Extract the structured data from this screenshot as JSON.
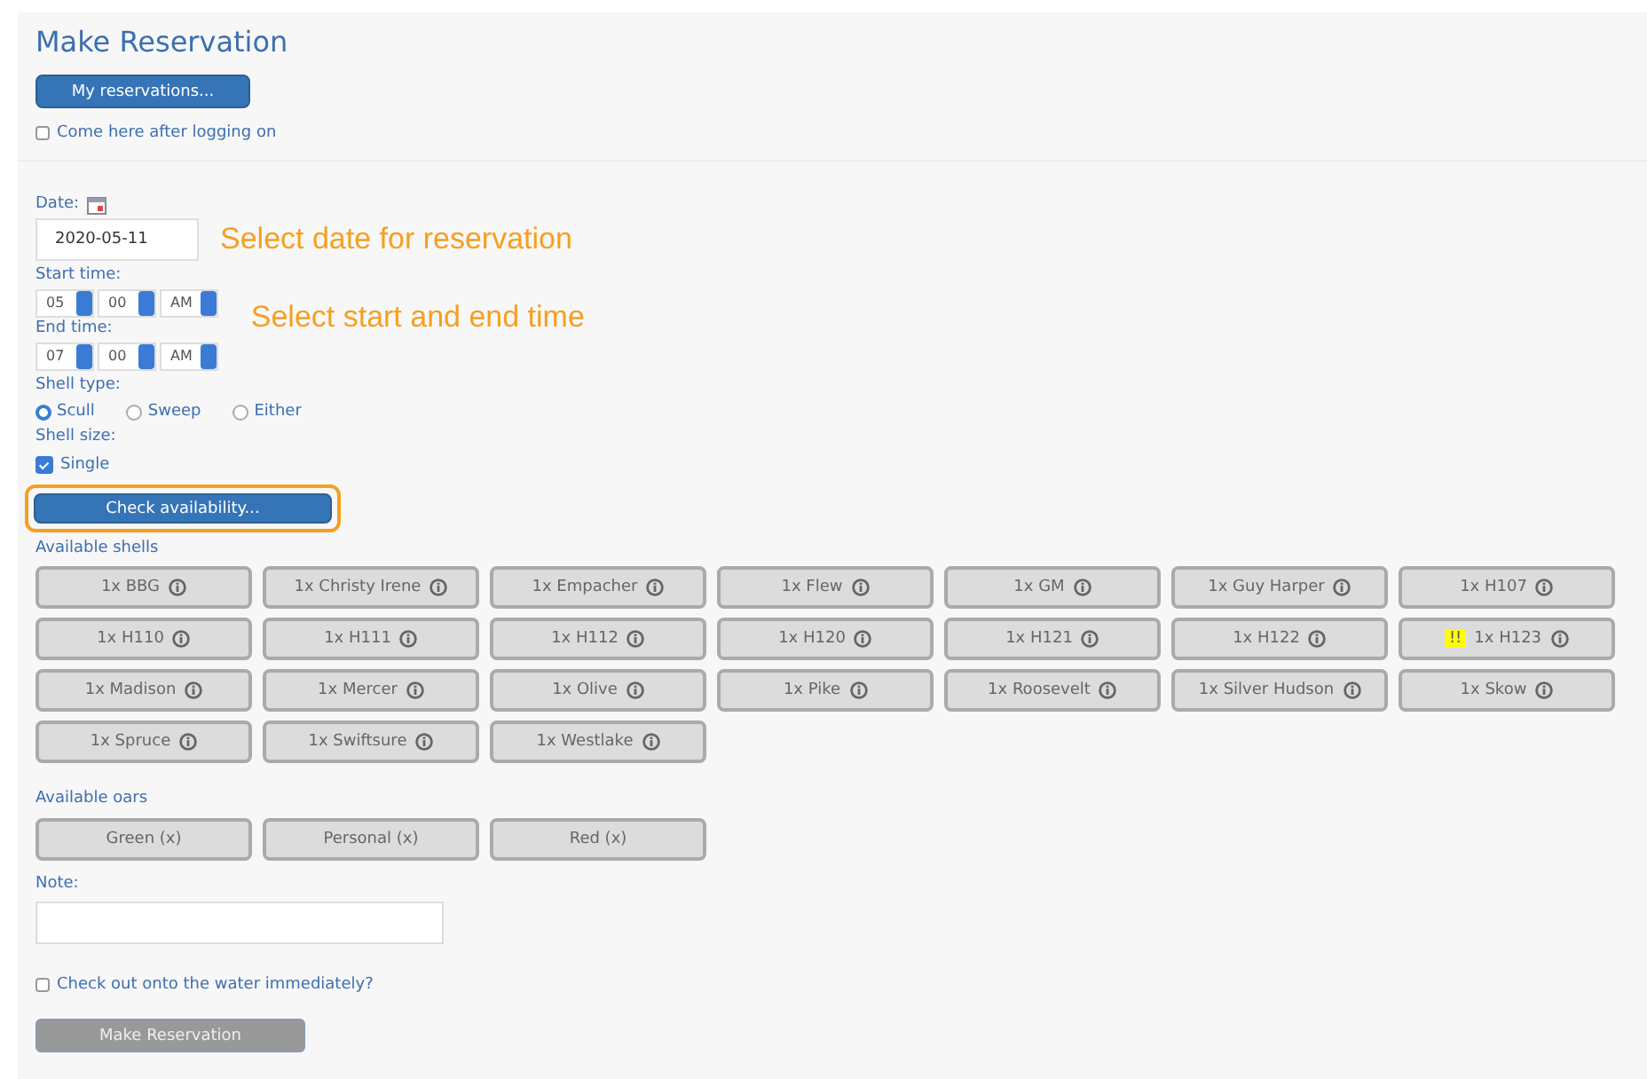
{
  "title": "Make Reservation",
  "my_reservations_button": "My reservations...",
  "come_here": {
    "label": "Come here after logging on",
    "checked": false
  },
  "date": {
    "label": "Date:",
    "value": "2020-05-11",
    "annotation": "Select date for reservation"
  },
  "start_time": {
    "label": "Start time:",
    "hour": "05",
    "minute": "00",
    "ampm": "AM"
  },
  "end_time": {
    "label": "End time:",
    "hour": "07",
    "minute": "00",
    "ampm": "AM"
  },
  "time_annotation": "Select start and end time",
  "shell_type": {
    "label": "Shell type:",
    "options": [
      {
        "label": "Scull",
        "selected": true
      },
      {
        "label": "Sweep",
        "selected": false
      },
      {
        "label": "Either",
        "selected": false
      }
    ]
  },
  "shell_size": {
    "label": "Shell size:",
    "options": [
      {
        "label": "Single",
        "checked": true
      }
    ]
  },
  "check_button": {
    "label": "Check availability...",
    "highlighted": true
  },
  "available_shells": {
    "label": "Available shells",
    "shells": [
      {
        "label": "1x BBG"
      },
      {
        "label": "1x Christy Irene"
      },
      {
        "label": "1x Empacher"
      },
      {
        "label": "1x Flew"
      },
      {
        "label": "1x GM"
      },
      {
        "label": "1x Guy Harper"
      },
      {
        "label": "1x H107"
      },
      {
        "label": "1x H110"
      },
      {
        "label": "1x H111"
      },
      {
        "label": "1x H112"
      },
      {
        "label": "1x H120"
      },
      {
        "label": "1x H121"
      },
      {
        "label": "1x H122"
      },
      {
        "label": "1x H123",
        "flag": "!!"
      },
      {
        "label": "1x Madison"
      },
      {
        "label": "1x Mercer"
      },
      {
        "label": "1x Olive"
      },
      {
        "label": "1x Pike"
      },
      {
        "label": "1x Roosevelt"
      },
      {
        "label": "1x Silver Hudson"
      },
      {
        "label": "1x Skow"
      },
      {
        "label": "1x Spruce"
      },
      {
        "label": "1x Swiftsure"
      },
      {
        "label": "1x Westlake"
      }
    ]
  },
  "available_oars": {
    "label": "Available oars",
    "oars": [
      "Green (x)",
      "Personal (x)",
      "Red (x)"
    ]
  },
  "note": {
    "label": "Note:"
  },
  "check_out": {
    "label": "Check out onto the water immediately?",
    "checked": false
  },
  "make_button": {
    "label": "Make Reservation",
    "disabled": true
  }
}
